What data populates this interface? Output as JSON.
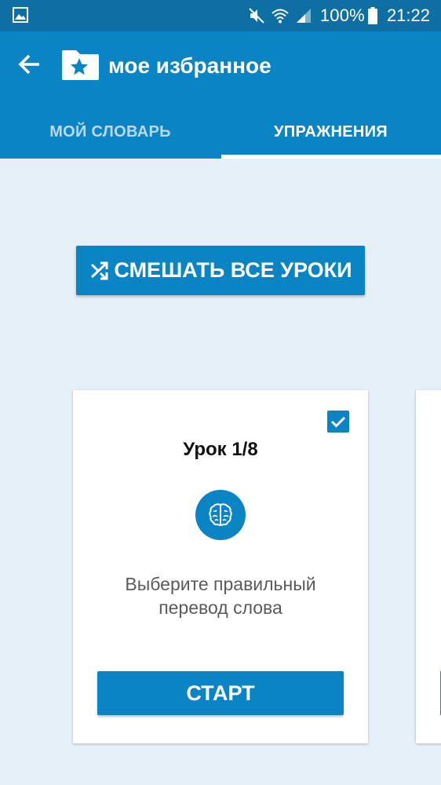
{
  "status_bar": {
    "battery_percent": "100%",
    "time": "21:22",
    "icons": [
      "gallery-icon",
      "mute-icon",
      "wifi-icon",
      "signal-icon",
      "battery-icon"
    ]
  },
  "app_bar": {
    "title": "мое избранное",
    "back_icon": "arrow-left-icon",
    "folder_icon": "star-folder-icon"
  },
  "tabs": [
    {
      "label": "МОЙ СЛОВАРЬ",
      "active": false
    },
    {
      "label": "УПРАЖНЕНИЯ",
      "active": true
    }
  ],
  "shuffle_button": {
    "label": "СМЕШАТЬ ВСЕ УРОКИ",
    "icon": "shuffle-icon"
  },
  "lesson_card": {
    "title": "Урок 1/8",
    "checked": true,
    "icon": "brain-icon",
    "description": "Выберите правильный перевод слова",
    "start_label": "СТАРТ"
  },
  "colors": {
    "primary": "#0b84c4",
    "status_bar": "#0e6fa2",
    "background": "#e6f0f8",
    "tab_inactive": "#b9d9ee"
  }
}
